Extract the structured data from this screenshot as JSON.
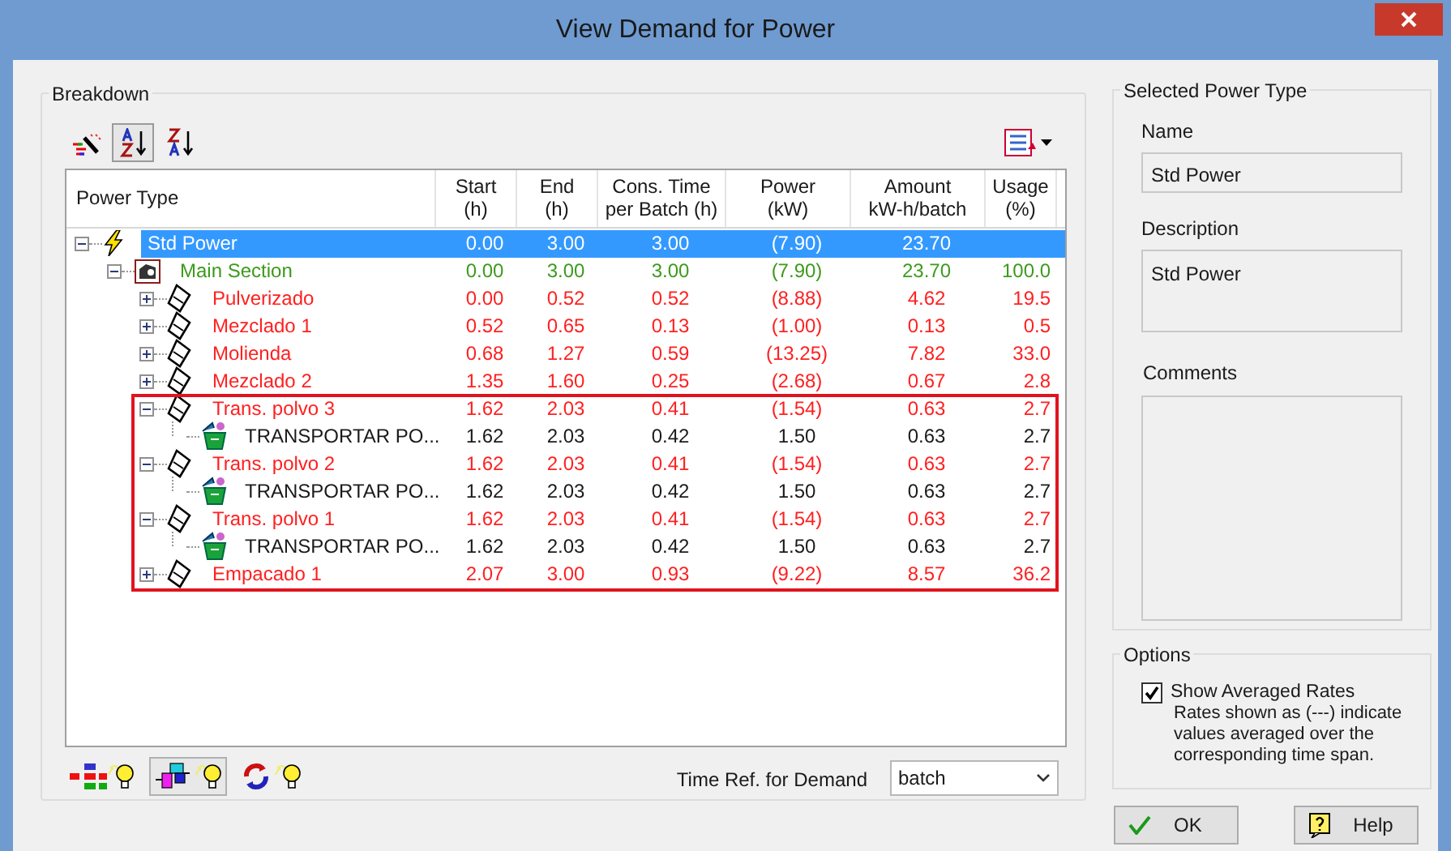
{
  "window": {
    "title": "View Demand for Power"
  },
  "breakdown": {
    "title": "Breakdown",
    "toolbar": [
      {
        "kind": "wand",
        "selected": false
      },
      {
        "kind": "sort-az",
        "selected": true
      },
      {
        "kind": "sort-za",
        "selected": false
      }
    ],
    "columns": [
      "Power Type",
      "Start\n(h)",
      "End\n(h)",
      "Cons. Time\nper Batch (h)",
      "Power\n(kW)",
      "Amount\nkW-h/batch",
      "Usage\n(%)"
    ],
    "tree": [
      {
        "kind": "power",
        "label": "Std Power",
        "selected": true,
        "expanded": true,
        "highlighted": false,
        "values": [
          "0.00",
          "3.00",
          "3.00",
          "(7.90)",
          "23.70"
        ],
        "children": [
          {
            "kind": "section",
            "label": "Main Section",
            "selected": false,
            "expanded": true,
            "highlighted": false,
            "values": [
              "0.00",
              "3.00",
              "3.00",
              "(7.90)",
              "23.70",
              "100.0"
            ],
            "children": [
              {
                "kind": "step",
                "label": "Pulverizado",
                "selected": false,
                "expanded": false,
                "highlighted": false,
                "values": [
                  "0.00",
                  "0.52",
                  "0.52",
                  "(8.88)",
                  "4.62",
                  "19.5"
                ]
              },
              {
                "kind": "step",
                "label": "Mezclado 1",
                "selected": false,
                "expanded": false,
                "highlighted": false,
                "values": [
                  "0.52",
                  "0.65",
                  "0.13",
                  "(1.00)",
                  "0.13",
                  "0.5"
                ]
              },
              {
                "kind": "step",
                "label": "Molienda",
                "selected": false,
                "expanded": false,
                "highlighted": false,
                "values": [
                  "0.68",
                  "1.27",
                  "0.59",
                  "(13.25)",
                  "7.82",
                  "33.0"
                ]
              },
              {
                "kind": "step",
                "label": "Mezclado 2",
                "selected": false,
                "expanded": false,
                "highlighted": false,
                "values": [
                  "1.35",
                  "1.60",
                  "0.25",
                  "(2.68)",
                  "0.67",
                  "2.8"
                ]
              },
              {
                "kind": "step",
                "label": "Trans. polvo 3",
                "selected": false,
                "expanded": true,
                "highlighted": true,
                "values": [
                  "1.62",
                  "2.03",
                  "0.41",
                  "(1.54)",
                  "0.63",
                  "2.7"
                ],
                "children": [
                  {
                    "kind": "equipment",
                    "label": "TRANSPORTAR PO...",
                    "selected": false,
                    "highlighted": true,
                    "values": [
                      "1.62",
                      "2.03",
                      "0.42",
                      "1.50",
                      "0.63",
                      "2.7"
                    ]
                  }
                ]
              },
              {
                "kind": "step",
                "label": "Trans. polvo 2",
                "selected": false,
                "expanded": true,
                "highlighted": true,
                "values": [
                  "1.62",
                  "2.03",
                  "0.41",
                  "(1.54)",
                  "0.63",
                  "2.7"
                ],
                "children": [
                  {
                    "kind": "equipment",
                    "label": "TRANSPORTAR PO...",
                    "selected": false,
                    "highlighted": true,
                    "values": [
                      "1.62",
                      "2.03",
                      "0.42",
                      "1.50",
                      "0.63",
                      "2.7"
                    ]
                  }
                ]
              },
              {
                "kind": "step",
                "label": "Trans. polvo 1",
                "selected": false,
                "expanded": true,
                "highlighted": true,
                "values": [
                  "1.62",
                  "2.03",
                  "0.41",
                  "(1.54)",
                  "0.63",
                  "2.7"
                ],
                "children": [
                  {
                    "kind": "equipment",
                    "label": "TRANSPORTAR PO...",
                    "selected": false,
                    "highlighted": true,
                    "values": [
                      "1.62",
                      "2.03",
                      "0.42",
                      "1.50",
                      "0.63",
                      "2.7"
                    ]
                  }
                ]
              },
              {
                "kind": "step",
                "label": "Empacado 1",
                "selected": false,
                "expanded": false,
                "highlighted": true,
                "values": [
                  "2.07",
                  "3.00",
                  "0.93",
                  "(9.22)",
                  "8.57",
                  "36.2"
                ]
              }
            ]
          }
        ]
      }
    ],
    "bottom_toolbar": [
      {
        "kind": "tree-bulb",
        "selected": false
      },
      {
        "kind": "flow-bulb",
        "selected": true
      },
      {
        "kind": "cycle-bulb",
        "selected": false
      }
    ],
    "time_ref": {
      "label": "Time Ref. for Demand",
      "value": "batch"
    }
  },
  "selected_power_type": {
    "title": "Selected Power Type",
    "name_label": "Name",
    "name": "Std Power",
    "description_label": "Description",
    "description": "Std Power",
    "comments_label": "Comments"
  },
  "options": {
    "title": "Options",
    "show_averaged": {
      "label": "Show Averaged Rates",
      "checked": true
    },
    "note": "Rates shown as (---) indicate\nvalues averaged over the\ncorresponding time span."
  },
  "buttons": [
    {
      "kind": "ok",
      "label": "OK"
    },
    {
      "kind": "help",
      "label": "Help"
    }
  ]
}
